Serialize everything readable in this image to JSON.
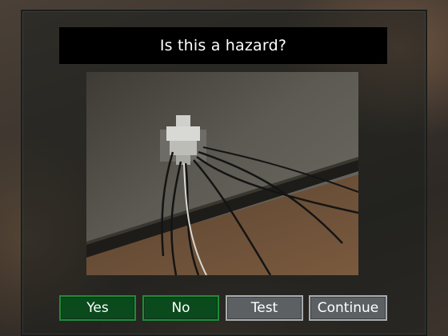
{
  "dialog": {
    "question": "Is this a hazard?"
  },
  "buttons": {
    "yes": "Yes",
    "no": "No",
    "test": "Test",
    "continue": "Continue"
  },
  "colors": {
    "answer_button_bg": "#0a4a1c",
    "answer_button_border": "#1f8a3a",
    "action_button_bg": "#5d6063",
    "action_button_border": "#a8abae",
    "title_bar_bg": "#000000"
  },
  "scene": {
    "subject": "wall-outlet-multiplug-adapter"
  }
}
